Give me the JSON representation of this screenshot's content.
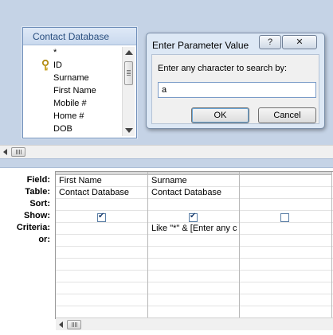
{
  "table_window": {
    "title": "Contact Database",
    "fields": [
      {
        "label": "*",
        "key": false
      },
      {
        "label": "ID",
        "key": true
      },
      {
        "label": "Surname",
        "key": false
      },
      {
        "label": "First Name",
        "key": false
      },
      {
        "label": "Mobile #",
        "key": false
      },
      {
        "label": "Home #",
        "key": false
      },
      {
        "label": "DOB",
        "key": false
      }
    ]
  },
  "dialog": {
    "title": "Enter Parameter Value",
    "help_label": "?",
    "close_label": "✕",
    "prompt": "Enter any character to search by:",
    "input_value": "a",
    "ok_label": "OK",
    "cancel_label": "Cancel"
  },
  "qbe": {
    "row_labels": [
      "Field:",
      "Table:",
      "Sort:",
      "Show:",
      "Criteria:",
      "or:"
    ],
    "columns": [
      {
        "field": "First Name",
        "table": "Contact Database",
        "sort": "",
        "show": true,
        "criteria": "",
        "or": ""
      },
      {
        "field": "Surname",
        "table": "Contact Database",
        "sort": "",
        "show": true,
        "criteria": "Like \"*\" & [Enter any c",
        "or": ""
      },
      {
        "field": "",
        "table": "",
        "sort": "",
        "show": false,
        "criteria": "",
        "or": ""
      }
    ]
  },
  "colors": {
    "design_background": "#c5d3e6",
    "dialog_background": "#dde8f5",
    "key_icon": "#c8a020"
  }
}
